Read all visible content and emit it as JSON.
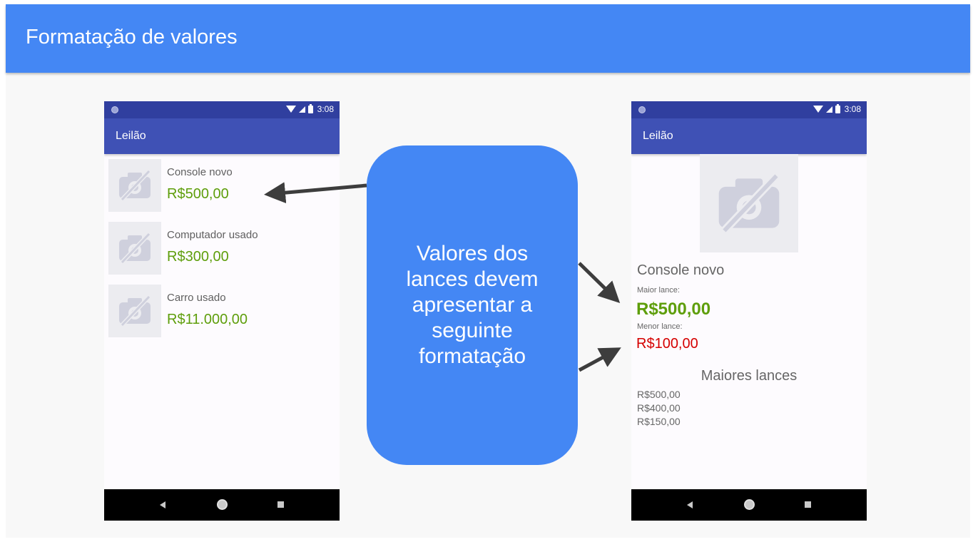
{
  "slide": {
    "title": "Formatação de valores"
  },
  "status_bar": {
    "time": "3:08"
  },
  "app_bar": {
    "title": "Leilão"
  },
  "list_screen": {
    "items": [
      {
        "name": "Console novo",
        "price": "R$500,00"
      },
      {
        "name": "Computador usado",
        "price": "R$300,00"
      },
      {
        "name": "Carro usado",
        "price": "R$11.000,00"
      }
    ]
  },
  "detail_screen": {
    "name": "Console novo",
    "max_bid_label": "Maior lance:",
    "max_bid_value": "R$500,00",
    "min_bid_label": "Menor lance:",
    "min_bid_value": "R$100,00",
    "top_bids_title": "Maiores lances",
    "top_bids": [
      "R$500,00",
      "R$400,00",
      "R$150,00"
    ]
  },
  "callout": {
    "text": "Valores dos lances devem apresentar a seguinte formatação"
  },
  "colors": {
    "slide_header": "#4487f4",
    "status_bar": "#303f9f",
    "app_bar": "#3f51b5",
    "price_green": "#5e9e0b",
    "price_red": "#d50000",
    "callout": "#4487f4"
  },
  "icons": {
    "thumbnail": "no-image-camera-icon",
    "nav_back": "back-triangle-icon",
    "nav_home": "home-circle-icon",
    "nav_recent": "recent-square-icon"
  }
}
